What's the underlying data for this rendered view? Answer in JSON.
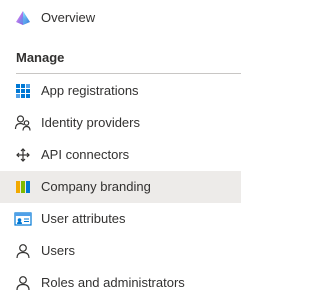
{
  "nav": {
    "overview": {
      "label": "Overview",
      "icon": "overview-icon"
    },
    "section_title": "Manage",
    "items": [
      {
        "label": "App registrations",
        "icon": "grid-icon",
        "selected": false
      },
      {
        "label": "Identity providers",
        "icon": "identity-icon",
        "selected": false
      },
      {
        "label": "API connectors",
        "icon": "api-connectors-icon",
        "selected": false
      },
      {
        "label": "Company branding",
        "icon": "branding-icon",
        "selected": true
      },
      {
        "label": "User attributes",
        "icon": "id-card-icon",
        "selected": false
      },
      {
        "label": "Users",
        "icon": "user-icon",
        "selected": false
      },
      {
        "label": "Roles and administrators",
        "icon": "user-icon",
        "selected": false
      }
    ]
  },
  "colors": {
    "selected_bg": "#edebe9",
    "text": "#323130",
    "divider": "#c8c6c4",
    "azure_blue": "#0078d4"
  }
}
